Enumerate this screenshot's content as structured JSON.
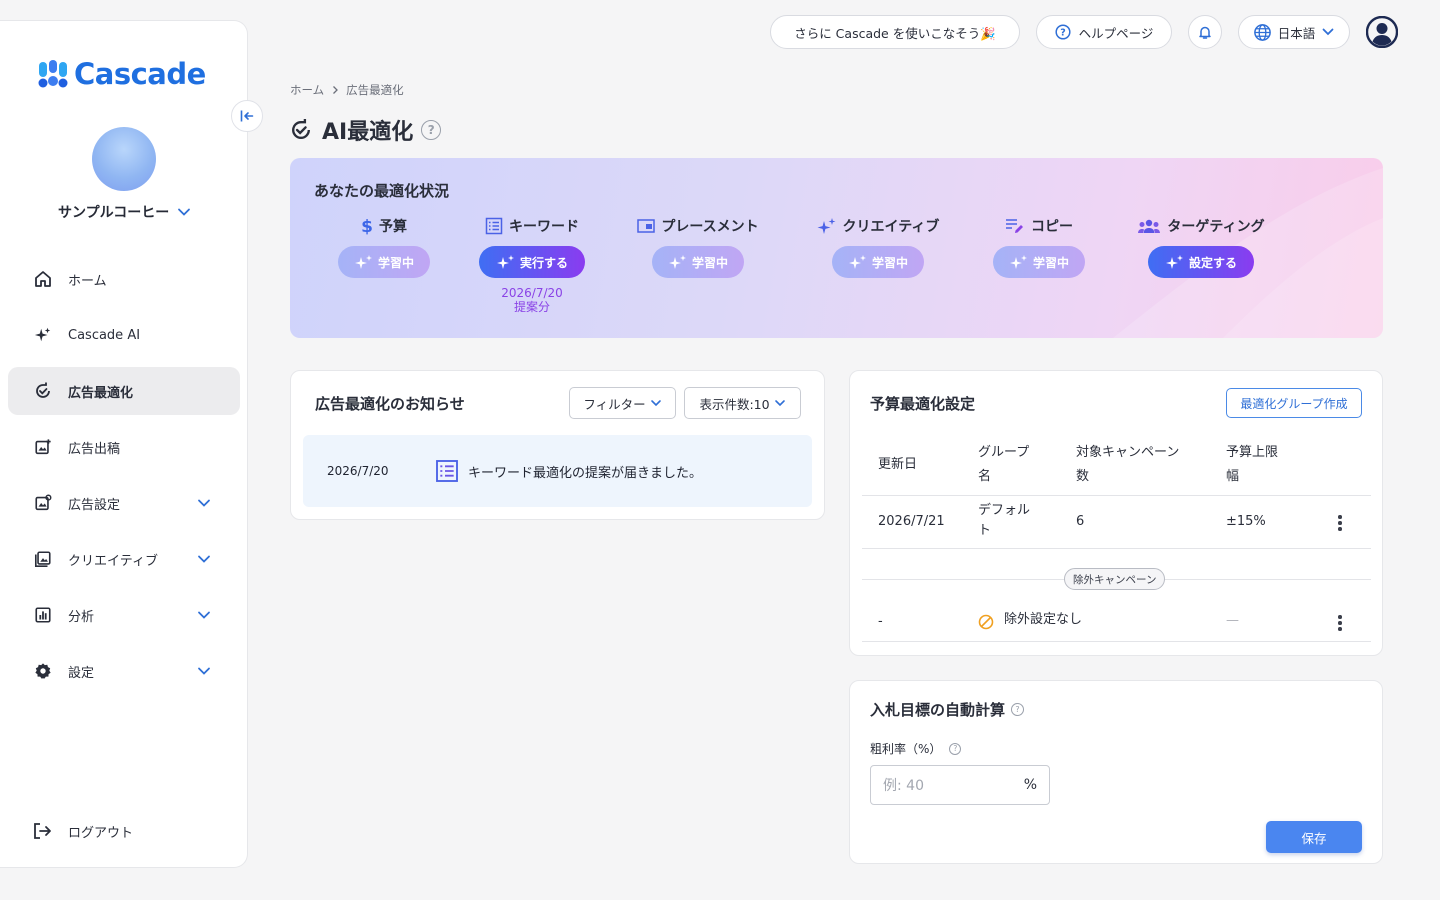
{
  "app": {
    "logo_text": "Cascade",
    "company_name": "サンプルコーヒー"
  },
  "colors": {
    "brand": "#1f6fe0",
    "accent_gradient_start": "#3f6ef3",
    "accent_gradient_end": "#8a3cf0",
    "note": "#8a43e6"
  },
  "sidebar": {
    "items": [
      {
        "label": "ホーム",
        "icon": "home-icon"
      },
      {
        "label": "Cascade AI",
        "icon": "sparkle-icon"
      },
      {
        "label": "広告最適化",
        "icon": "optimize-icon",
        "active": true
      },
      {
        "label": "広告出稿",
        "icon": "ad-publish-icon"
      },
      {
        "label": "広告設定",
        "icon": "ad-settings-icon",
        "expandable": true
      },
      {
        "label": "クリエイティブ",
        "icon": "image-icon",
        "expandable": true
      },
      {
        "label": "分析",
        "icon": "analytics-icon",
        "expandable": true
      },
      {
        "label": "設定",
        "icon": "gear-icon",
        "expandable": true
      }
    ],
    "logout_label": "ログアウト"
  },
  "topbar": {
    "promo_label": "さらに Cascade を使いこなそう🎉",
    "help_label": "ヘルプページ",
    "language_label": "日本語"
  },
  "breadcrumb": {
    "home": "ホーム",
    "current": "広告最適化"
  },
  "page": {
    "title": "AI最適化"
  },
  "status": {
    "title": "あなたの最適化状況",
    "items": [
      {
        "label": "予算",
        "icon": "dollar-icon",
        "button": "学習中",
        "state": "learning"
      },
      {
        "label": "キーワード",
        "icon": "list-icon",
        "button": "実行する",
        "state": "action",
        "note_line1": "2026/7/20",
        "note_line2": "提案分"
      },
      {
        "label": "プレースメント",
        "icon": "placement-icon",
        "button": "学習中",
        "state": "learning"
      },
      {
        "label": "クリエイティブ",
        "icon": "sparkle-icon",
        "button": "学習中",
        "state": "learning"
      },
      {
        "label": "コピー",
        "icon": "edit-text-icon",
        "button": "学習中",
        "state": "learning"
      },
      {
        "label": "ターゲティング",
        "icon": "people-icon",
        "button": "設定する",
        "state": "action"
      }
    ]
  },
  "notices": {
    "title": "広告最適化のお知らせ",
    "filter_label": "フィルター",
    "page_size_label": "表示件数:10",
    "items": [
      {
        "date": "2026/7/20",
        "message": "キーワード最適化の提案が届きました。"
      }
    ]
  },
  "budget": {
    "title": "予算最適化設定",
    "create_group_label": "最適化グループ作成",
    "headers": {
      "updated": "更新日",
      "group_1": "グループ",
      "group_2": "名",
      "campaigns_1": "対象キャンペーン",
      "campaigns_2": "数",
      "limit_1": "予算上限",
      "limit_2": "幅"
    },
    "rows": [
      {
        "updated": "2026/7/21",
        "group_1": "デフォル",
        "group_2": "ト",
        "campaigns": "6",
        "limit": "±15%"
      }
    ],
    "excluded_label": "除外キャンペーン",
    "excluded_row": {
      "updated": "-",
      "status": "除外設定なし",
      "limit": "—"
    }
  },
  "bid": {
    "title": "入札目標の自動計算",
    "margin_label": "粗利率（%）",
    "input_placeholder": "例: 40",
    "unit": "%",
    "save_label": "保存"
  }
}
